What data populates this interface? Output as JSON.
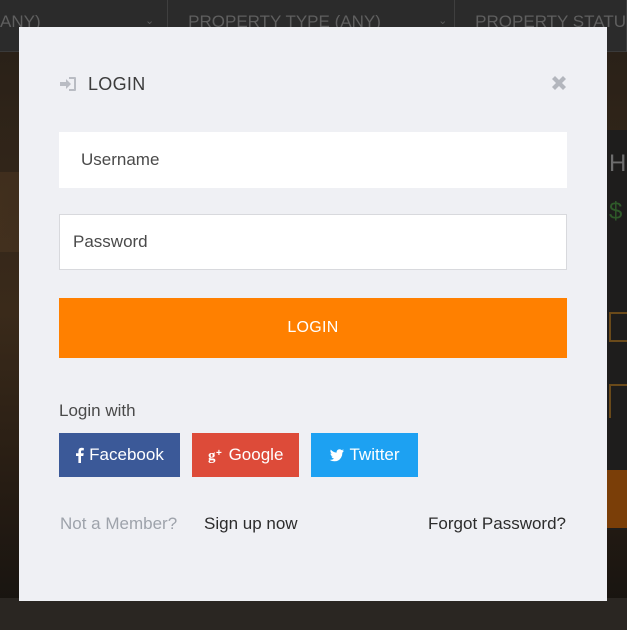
{
  "background": {
    "search_fields": [
      {
        "label": "ANY)"
      },
      {
        "label": "PROPERTY TYPE (ANY)"
      },
      {
        "label": "PROPERTY STATU"
      }
    ],
    "side_title": "H",
    "side_price": "$"
  },
  "modal": {
    "title": "LOGIN",
    "username_placeholder": "Username",
    "password_placeholder": "Password",
    "login_button": "LOGIN",
    "login_with": "Login with",
    "social": {
      "facebook": "Facebook",
      "google": "Google",
      "twitter": "Twitter"
    },
    "not_member": "Not a Member?",
    "signup": "Sign up now",
    "forgot": "Forgot Password?"
  },
  "colors": {
    "accent": "#ff8000",
    "facebook": "#3b5998",
    "google": "#dd4b39",
    "twitter": "#1da1f2",
    "modal_bg": "#eff0f4"
  },
  "icons": {
    "header": "sign-in-icon",
    "close": "close-icon",
    "facebook": "facebook-icon",
    "google": "google-plus-icon",
    "twitter": "twitter-icon"
  }
}
